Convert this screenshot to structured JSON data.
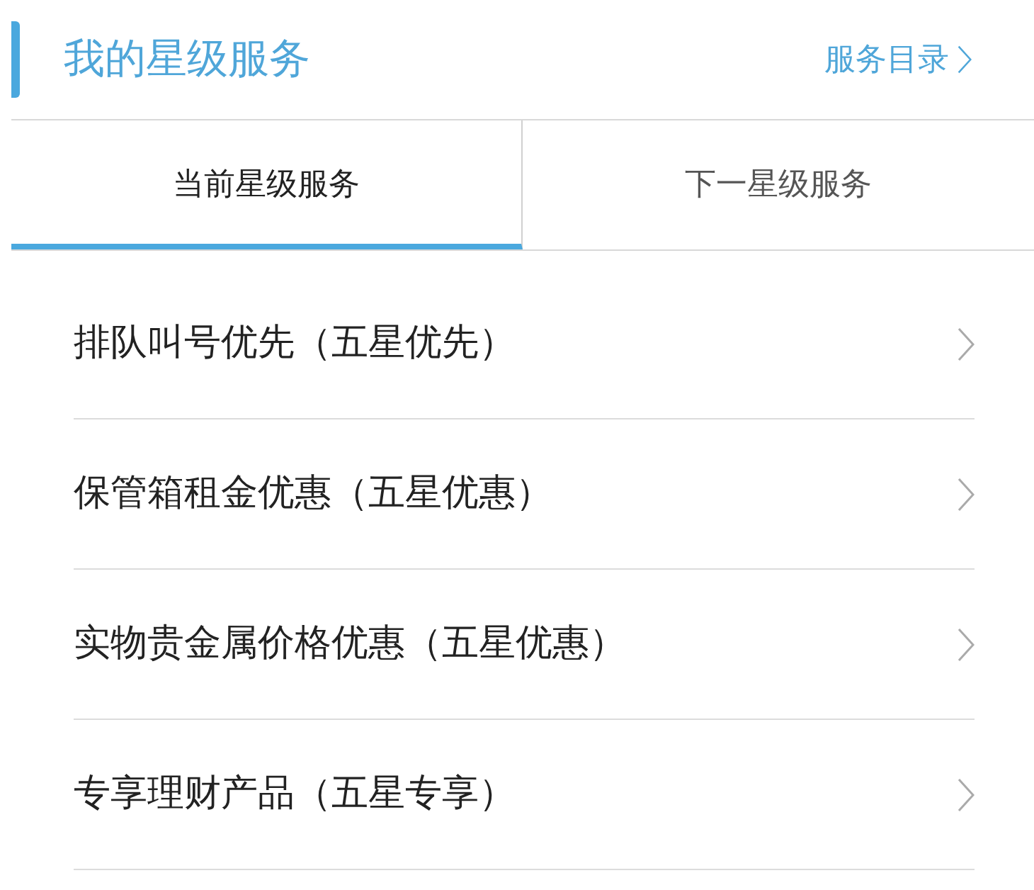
{
  "header": {
    "title": "我的星级服务",
    "link": "服务目录"
  },
  "tabs": [
    {
      "label": "当前星级服务",
      "selected": true
    },
    {
      "label": "下一星级服务",
      "selected": false
    }
  ],
  "services": [
    {
      "label": "排队叫号优先（五星优先）"
    },
    {
      "label": "保管箱租金优惠（五星优惠）"
    },
    {
      "label": "实物贵金属价格优惠（五星优惠）"
    },
    {
      "label": "专享理财产品（五星专享）"
    }
  ]
}
